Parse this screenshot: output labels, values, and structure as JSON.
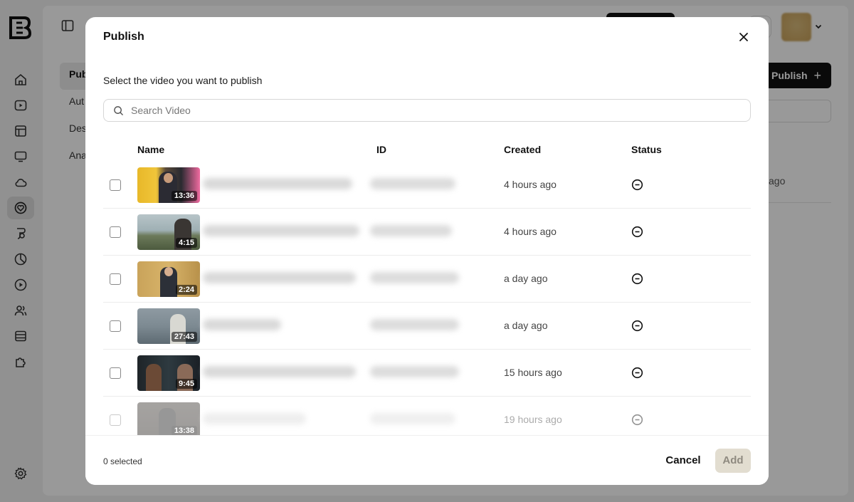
{
  "app": {
    "sub_nav": [
      "Pub",
      "Aut",
      "Des",
      "Ana"
    ],
    "publish_button_label": "Publish",
    "background_time_fragment": "ago"
  },
  "modal": {
    "title": "Publish",
    "prompt": "Select the video you want to publish",
    "search_placeholder": "Search Video",
    "columns": {
      "name": "Name",
      "id": "ID",
      "created": "Created",
      "status": "Status"
    },
    "rows": [
      {
        "duration": "13:36",
        "created": "4 hours ago",
        "status_icon": "minus-circle-icon"
      },
      {
        "duration": "4:15",
        "created": "4 hours ago",
        "status_icon": "minus-circle-icon"
      },
      {
        "duration": "2:24",
        "created": "a day ago",
        "status_icon": "minus-circle-icon"
      },
      {
        "duration": "27:43",
        "created": "a day ago",
        "status_icon": "minus-circle-icon"
      },
      {
        "duration": "9:45",
        "created": "15 hours ago",
        "status_icon": "minus-circle-icon"
      },
      {
        "duration": "13:38",
        "created": "19 hours ago",
        "status_icon": "minus-circle-icon"
      }
    ],
    "selected_count": "0 selected",
    "cancel_label": "Cancel",
    "add_label": "Add"
  },
  "colors": {
    "accent_dark": "#111111",
    "add_button_disabled_bg": "#e2ddd0",
    "overlay": "rgba(0,0,0,0.40)"
  }
}
